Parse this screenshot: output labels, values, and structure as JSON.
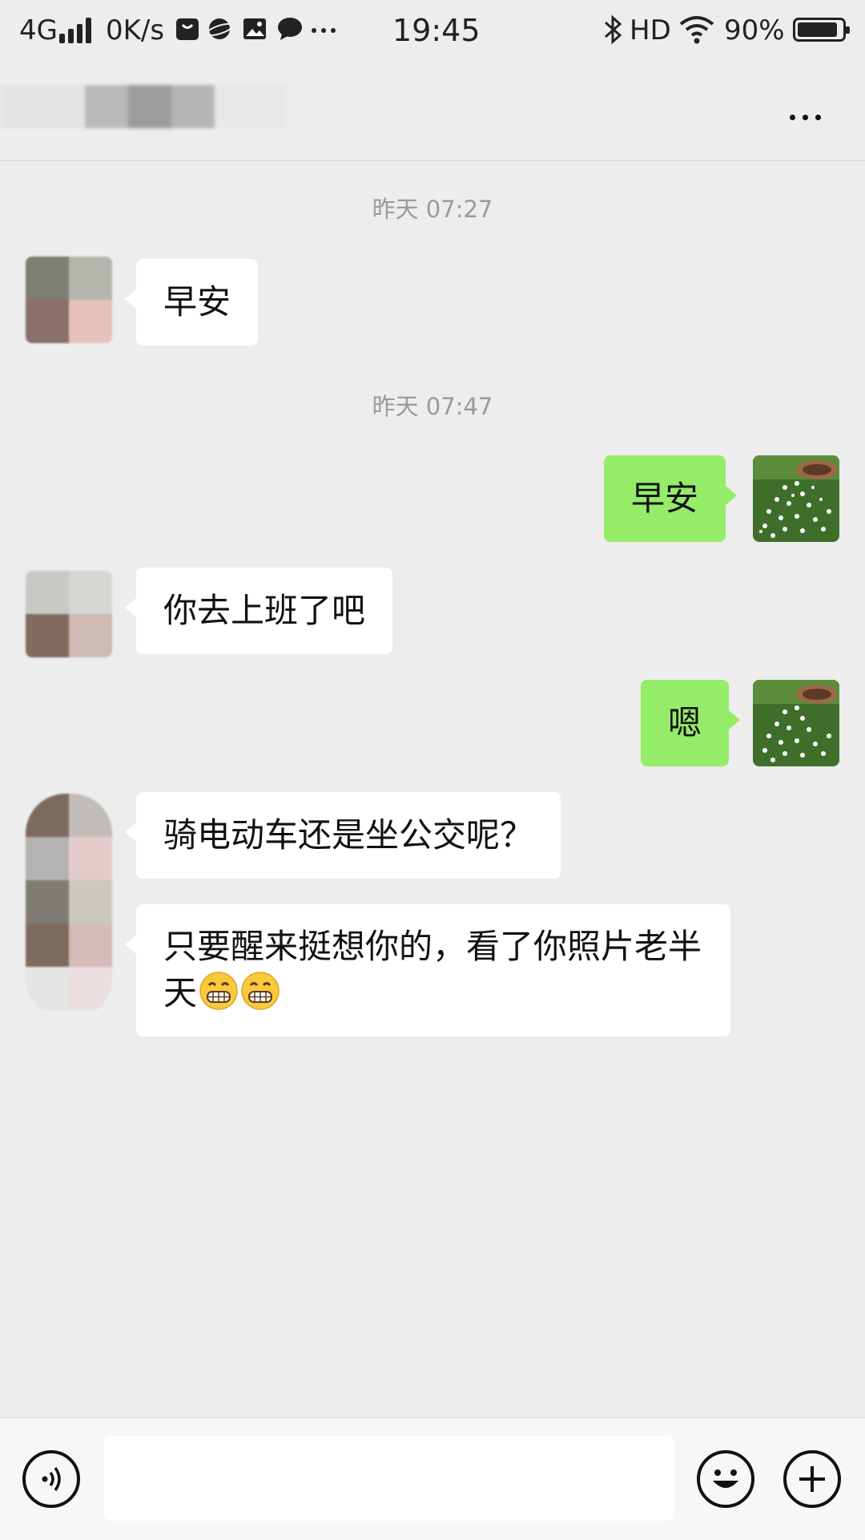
{
  "status_bar": {
    "network": "4G",
    "speed": "0K/s",
    "time": "19:45",
    "hd": "HD",
    "battery": "90%",
    "battery_level": 0.9
  },
  "header": {
    "more_icon": "more-dots-icon"
  },
  "messages": [
    {
      "type": "timestamp",
      "text": "昨天 07:27"
    },
    {
      "type": "incoming",
      "text": "早安"
    },
    {
      "type": "timestamp",
      "text": "昨天 07:47"
    },
    {
      "type": "outgoing",
      "text": "早安"
    },
    {
      "type": "incoming",
      "text": "你去上班了吧"
    },
    {
      "type": "outgoing",
      "text": "嗯"
    },
    {
      "type": "incoming",
      "text": "骑电动车还是坐公交呢？"
    },
    {
      "type": "incoming",
      "text": "只要醒来挺想你的，看了你照片老半天"
    }
  ],
  "input_bar": {
    "voice_icon": "voice-icon",
    "emoji_icon": "emoji-icon",
    "plus_icon": "plus-icon"
  },
  "colors": {
    "background": "#ededed",
    "outgoing_bubble": "#95ec69",
    "incoming_bubble": "#ffffff"
  }
}
